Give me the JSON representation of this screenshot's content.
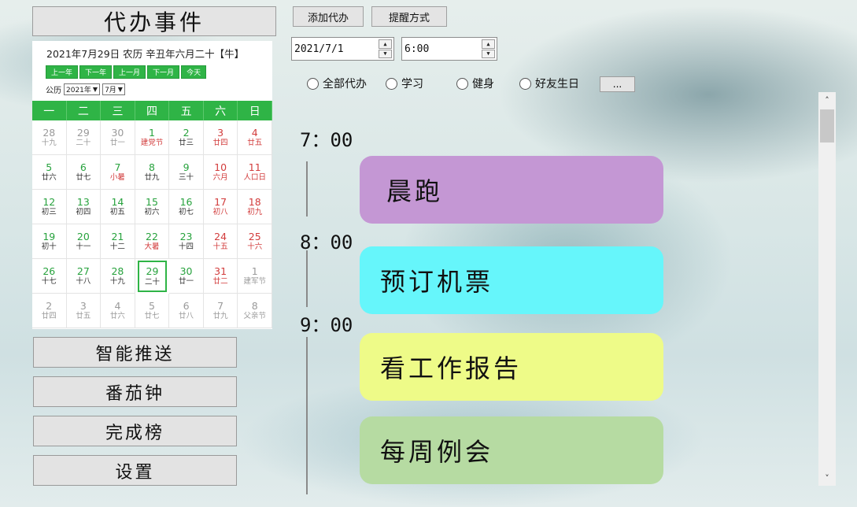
{
  "left_panel": {
    "title": "代办事件",
    "menu": [
      "智能推送",
      "番茄钟",
      "完成榜",
      "设置"
    ]
  },
  "calendar": {
    "header": "2021年7月29日 农历 辛丑年六月二十【牛】",
    "nav_buttons": [
      "上一年",
      "下一年",
      "上一月",
      "下一月",
      "今天"
    ],
    "selects_label": "公历",
    "year_select": "2021年",
    "month_select": "7月",
    "weekdays": [
      "一",
      "二",
      "三",
      "四",
      "五",
      "六",
      "日"
    ],
    "rows": [
      [
        [
          "28",
          "十九",
          "other",
          ""
        ],
        [
          "29",
          "二十",
          "other",
          ""
        ],
        [
          "30",
          "廿一",
          "other",
          ""
        ],
        [
          "1",
          "建党节",
          "cur",
          "fest"
        ],
        [
          "2",
          "廿三",
          "cur",
          ""
        ],
        [
          "3",
          "廿四",
          "wk",
          ""
        ],
        [
          "4",
          "廿五",
          "wk",
          ""
        ]
      ],
      [
        [
          "5",
          "廿六",
          "cur",
          ""
        ],
        [
          "6",
          "廿七",
          "cur",
          ""
        ],
        [
          "7",
          "小暑",
          "cur",
          "fest"
        ],
        [
          "8",
          "廿九",
          "cur",
          ""
        ],
        [
          "9",
          "三十",
          "cur",
          ""
        ],
        [
          "10",
          "六月",
          "wk",
          ""
        ],
        [
          "11",
          "人口日",
          "wk",
          ""
        ]
      ],
      [
        [
          "12",
          "初三",
          "cur",
          ""
        ],
        [
          "13",
          "初四",
          "cur",
          ""
        ],
        [
          "14",
          "初五",
          "cur",
          ""
        ],
        [
          "15",
          "初六",
          "cur",
          ""
        ],
        [
          "16",
          "初七",
          "cur",
          ""
        ],
        [
          "17",
          "初八",
          "wk",
          ""
        ],
        [
          "18",
          "初九",
          "wk",
          ""
        ]
      ],
      [
        [
          "19",
          "初十",
          "cur",
          ""
        ],
        [
          "20",
          "十一",
          "cur",
          ""
        ],
        [
          "21",
          "十二",
          "cur",
          ""
        ],
        [
          "22",
          "大暑",
          "cur",
          "fest"
        ],
        [
          "23",
          "十四",
          "cur",
          ""
        ],
        [
          "24",
          "十五",
          "wk",
          ""
        ],
        [
          "25",
          "十六",
          "wk",
          ""
        ]
      ],
      [
        [
          "26",
          "十七",
          "cur",
          ""
        ],
        [
          "27",
          "十八",
          "cur",
          ""
        ],
        [
          "28",
          "十九",
          "cur",
          ""
        ],
        [
          "29",
          "二十",
          "cur",
          "selected"
        ],
        [
          "30",
          "廿一",
          "cur",
          ""
        ],
        [
          "31",
          "廿二",
          "wk",
          ""
        ],
        [
          "1",
          "建军节",
          "other",
          ""
        ]
      ],
      [
        [
          "2",
          "廿四",
          "other",
          ""
        ],
        [
          "3",
          "廿五",
          "other",
          ""
        ],
        [
          "4",
          "廿六",
          "other",
          ""
        ],
        [
          "5",
          "廿七",
          "other",
          ""
        ],
        [
          "6",
          "廿八",
          "other",
          ""
        ],
        [
          "7",
          "廿九",
          "other",
          ""
        ],
        [
          "8",
          "父亲节",
          "other",
          ""
        ]
      ]
    ]
  },
  "toolbar": {
    "add_todo": "添加代办",
    "reminder_method": "提醒方式",
    "date_value": "2021/7/1",
    "time_value": "6:00",
    "spin_up": "▲",
    "spin_down": "▼",
    "filters": [
      "全部代办",
      "学习",
      "健身",
      "好友生日"
    ],
    "more": "..."
  },
  "timeline": {
    "times": [
      "7：00",
      "8：00",
      "9：00"
    ],
    "tasks": [
      {
        "label": "晨跑",
        "color": "#c497d4"
      },
      {
        "label": "预订机票",
        "color": "#66f6fb"
      },
      {
        "label": "看工作报告",
        "color": "#eefb88"
      },
      {
        "label": "每周例会",
        "color": "#b6dba2"
      }
    ]
  },
  "scrollbar": {
    "up": "˄",
    "down": "˅"
  }
}
